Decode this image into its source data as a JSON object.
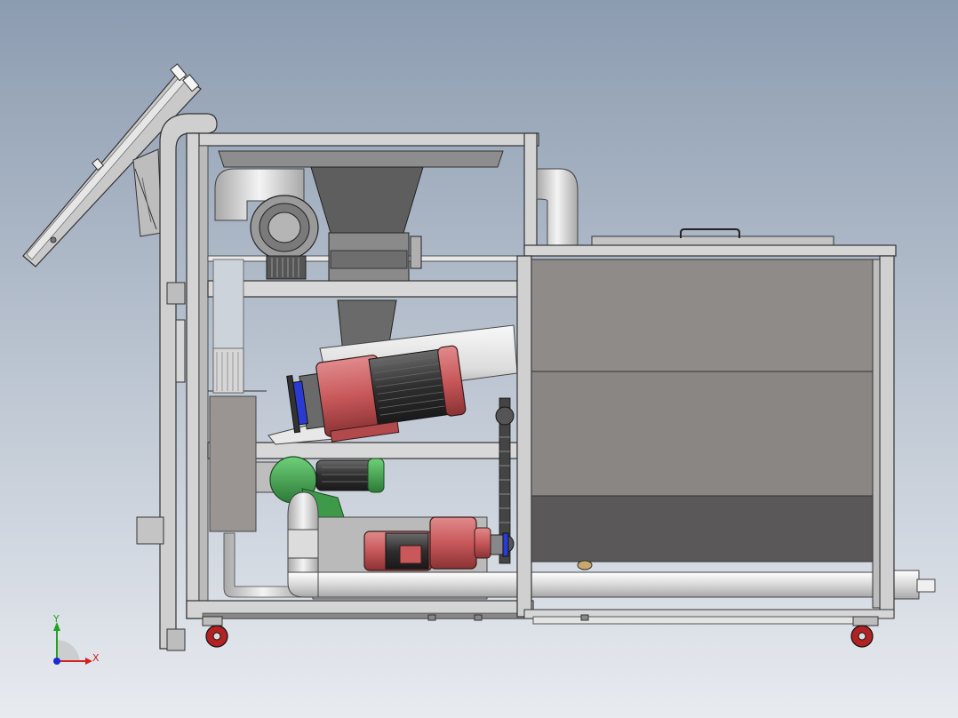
{
  "viewport": {
    "background_top": "#8c9cb0",
    "background_bottom": "#e8ebf0"
  },
  "axis_triad": {
    "x_label": "X",
    "y_label": "Y",
    "x_color": "#d42020",
    "y_color": "#1fa31f",
    "z_color": "#1a2bd4"
  },
  "palette": {
    "frame": "#c8c8c8",
    "frame_dark": "#555555",
    "panel_gray": "#8f8b88",
    "panel_dark": "#5a5858",
    "motor_red": "#c8585a",
    "motor_dark": "#3a3a3a",
    "blower_green": "#3fa04a",
    "pipe": "#e4e4e4",
    "wheel_red": "#b22222"
  }
}
